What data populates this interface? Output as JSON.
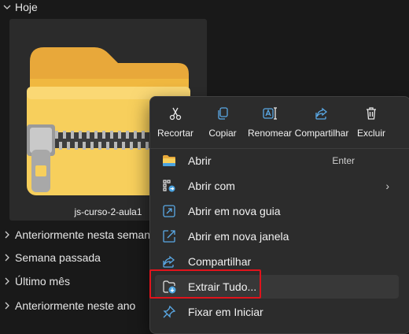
{
  "groups": {
    "today": "Hoje",
    "earlier_week": "Anteriormente nesta semana",
    "last_week": "Semana passada",
    "last_month": "Último mês",
    "earlier_year": "Anteriormente neste ano"
  },
  "file": {
    "name": "js-curso-2-aula1",
    "icon": "zip-folder-icon"
  },
  "context_menu": {
    "toolbar": [
      {
        "label": "Recortar",
        "icon": "scissors-icon"
      },
      {
        "label": "Copiar",
        "icon": "copy-icon"
      },
      {
        "label": "Renomear",
        "icon": "rename-icon"
      },
      {
        "label": "Compartilhar",
        "icon": "share-icon"
      },
      {
        "label": "Excluir",
        "icon": "trash-icon"
      }
    ],
    "items": [
      {
        "label": "Abrir",
        "shortcut": "Enter",
        "icon": "folder-open-icon"
      },
      {
        "label": "Abrir com",
        "icon": "open-with-icon",
        "submenu": "›"
      },
      {
        "label": "Abrir em nova guia",
        "icon": "new-tab-icon"
      },
      {
        "label": "Abrir em nova janela",
        "icon": "new-window-icon"
      },
      {
        "label": "Compartilhar",
        "icon": "share-icon"
      },
      {
        "label": "Extrair Tudo...",
        "icon": "extract-icon"
      },
      {
        "label": "Fixar em Iniciar",
        "icon": "pin-icon"
      }
    ]
  },
  "colors": {
    "background": "#191919",
    "menu": "#2c2c2c",
    "highlight": "#e0131b",
    "accent": "#4aa3e0"
  }
}
